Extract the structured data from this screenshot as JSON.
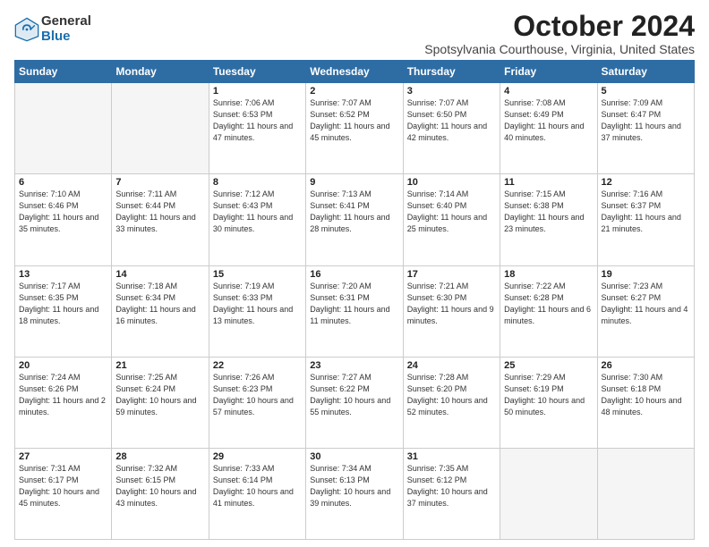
{
  "logo": {
    "general": "General",
    "blue": "Blue"
  },
  "title": "October 2024",
  "subtitle": "Spotsylvania Courthouse, Virginia, United States",
  "weekdays": [
    "Sunday",
    "Monday",
    "Tuesday",
    "Wednesday",
    "Thursday",
    "Friday",
    "Saturday"
  ],
  "weeks": [
    [
      {
        "day": "",
        "info": ""
      },
      {
        "day": "",
        "info": ""
      },
      {
        "day": "1",
        "info": "Sunrise: 7:06 AM\nSunset: 6:53 PM\nDaylight: 11 hours and 47 minutes."
      },
      {
        "day": "2",
        "info": "Sunrise: 7:07 AM\nSunset: 6:52 PM\nDaylight: 11 hours and 45 minutes."
      },
      {
        "day": "3",
        "info": "Sunrise: 7:07 AM\nSunset: 6:50 PM\nDaylight: 11 hours and 42 minutes."
      },
      {
        "day": "4",
        "info": "Sunrise: 7:08 AM\nSunset: 6:49 PM\nDaylight: 11 hours and 40 minutes."
      },
      {
        "day": "5",
        "info": "Sunrise: 7:09 AM\nSunset: 6:47 PM\nDaylight: 11 hours and 37 minutes."
      }
    ],
    [
      {
        "day": "6",
        "info": "Sunrise: 7:10 AM\nSunset: 6:46 PM\nDaylight: 11 hours and 35 minutes."
      },
      {
        "day": "7",
        "info": "Sunrise: 7:11 AM\nSunset: 6:44 PM\nDaylight: 11 hours and 33 minutes."
      },
      {
        "day": "8",
        "info": "Sunrise: 7:12 AM\nSunset: 6:43 PM\nDaylight: 11 hours and 30 minutes."
      },
      {
        "day": "9",
        "info": "Sunrise: 7:13 AM\nSunset: 6:41 PM\nDaylight: 11 hours and 28 minutes."
      },
      {
        "day": "10",
        "info": "Sunrise: 7:14 AM\nSunset: 6:40 PM\nDaylight: 11 hours and 25 minutes."
      },
      {
        "day": "11",
        "info": "Sunrise: 7:15 AM\nSunset: 6:38 PM\nDaylight: 11 hours and 23 minutes."
      },
      {
        "day": "12",
        "info": "Sunrise: 7:16 AM\nSunset: 6:37 PM\nDaylight: 11 hours and 21 minutes."
      }
    ],
    [
      {
        "day": "13",
        "info": "Sunrise: 7:17 AM\nSunset: 6:35 PM\nDaylight: 11 hours and 18 minutes."
      },
      {
        "day": "14",
        "info": "Sunrise: 7:18 AM\nSunset: 6:34 PM\nDaylight: 11 hours and 16 minutes."
      },
      {
        "day": "15",
        "info": "Sunrise: 7:19 AM\nSunset: 6:33 PM\nDaylight: 11 hours and 13 minutes."
      },
      {
        "day": "16",
        "info": "Sunrise: 7:20 AM\nSunset: 6:31 PM\nDaylight: 11 hours and 11 minutes."
      },
      {
        "day": "17",
        "info": "Sunrise: 7:21 AM\nSunset: 6:30 PM\nDaylight: 11 hours and 9 minutes."
      },
      {
        "day": "18",
        "info": "Sunrise: 7:22 AM\nSunset: 6:28 PM\nDaylight: 11 hours and 6 minutes."
      },
      {
        "day": "19",
        "info": "Sunrise: 7:23 AM\nSunset: 6:27 PM\nDaylight: 11 hours and 4 minutes."
      }
    ],
    [
      {
        "day": "20",
        "info": "Sunrise: 7:24 AM\nSunset: 6:26 PM\nDaylight: 11 hours and 2 minutes."
      },
      {
        "day": "21",
        "info": "Sunrise: 7:25 AM\nSunset: 6:24 PM\nDaylight: 10 hours and 59 minutes."
      },
      {
        "day": "22",
        "info": "Sunrise: 7:26 AM\nSunset: 6:23 PM\nDaylight: 10 hours and 57 minutes."
      },
      {
        "day": "23",
        "info": "Sunrise: 7:27 AM\nSunset: 6:22 PM\nDaylight: 10 hours and 55 minutes."
      },
      {
        "day": "24",
        "info": "Sunrise: 7:28 AM\nSunset: 6:20 PM\nDaylight: 10 hours and 52 minutes."
      },
      {
        "day": "25",
        "info": "Sunrise: 7:29 AM\nSunset: 6:19 PM\nDaylight: 10 hours and 50 minutes."
      },
      {
        "day": "26",
        "info": "Sunrise: 7:30 AM\nSunset: 6:18 PM\nDaylight: 10 hours and 48 minutes."
      }
    ],
    [
      {
        "day": "27",
        "info": "Sunrise: 7:31 AM\nSunset: 6:17 PM\nDaylight: 10 hours and 45 minutes."
      },
      {
        "day": "28",
        "info": "Sunrise: 7:32 AM\nSunset: 6:15 PM\nDaylight: 10 hours and 43 minutes."
      },
      {
        "day": "29",
        "info": "Sunrise: 7:33 AM\nSunset: 6:14 PM\nDaylight: 10 hours and 41 minutes."
      },
      {
        "day": "30",
        "info": "Sunrise: 7:34 AM\nSunset: 6:13 PM\nDaylight: 10 hours and 39 minutes."
      },
      {
        "day": "31",
        "info": "Sunrise: 7:35 AM\nSunset: 6:12 PM\nDaylight: 10 hours and 37 minutes."
      },
      {
        "day": "",
        "info": ""
      },
      {
        "day": "",
        "info": ""
      }
    ]
  ]
}
